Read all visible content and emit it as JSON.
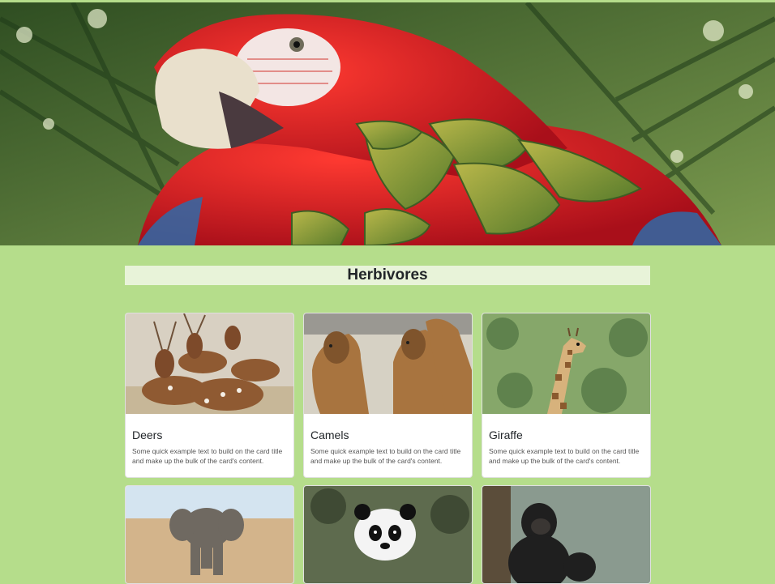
{
  "hero": {
    "image": "parrot-macaw-photo"
  },
  "section": {
    "title": "Herbivores"
  },
  "cards": [
    {
      "title": "Deers",
      "text": "Some quick example text to build on the card title and make up the bulk of the card's content.",
      "image": "deer-photo"
    },
    {
      "title": "Camels",
      "text": "Some quick example text to build on the card title and make up the bulk of the card's content.",
      "image": "camel-photo"
    },
    {
      "title": "Giraffe",
      "text": "Some quick example text to build on the card title and make up the bulk of the card's content.",
      "image": "giraffe-photo"
    },
    {
      "image": "elephant-photo"
    },
    {
      "image": "panda-photo"
    },
    {
      "image": "gorilla-photo"
    }
  ],
  "colors": {
    "page_bg": "#b5dd8b",
    "title_bg": "#e8f3d9"
  }
}
